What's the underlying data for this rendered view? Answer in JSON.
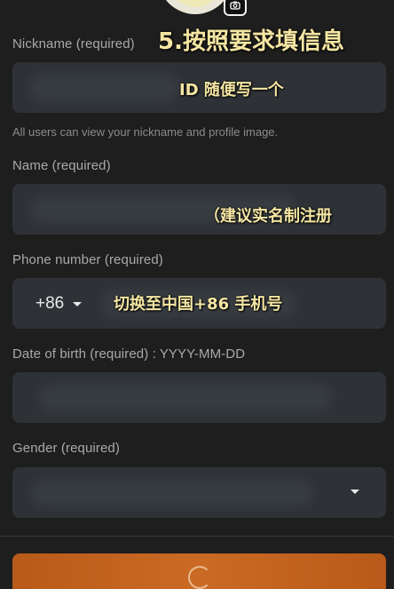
{
  "annotations": {
    "step_title": "5.按照要求填信息",
    "nickname_note": "ID 随便写一个",
    "name_note": "（建议实名制注册",
    "phone_note": "切换至中国+86 手机号"
  },
  "form": {
    "nickname": {
      "label": "Nickname (required)",
      "hint": "All users can view your nickname and profile image."
    },
    "name": {
      "label": "Name (required)"
    },
    "phone": {
      "label": "Phone number (required)",
      "country_code": "+86"
    },
    "dob": {
      "label": "Date of birth (required) : YYYY-MM-DD"
    },
    "gender": {
      "label": "Gender (required)"
    }
  },
  "icons": {
    "avatar_badge": "camera-icon",
    "country_caret": "caret-down-icon",
    "gender_caret": "caret-down-icon",
    "submit_spinner": "spinner-icon"
  },
  "colors": {
    "background": "#1e1e1e",
    "field": "#2e3236",
    "submit_button": "#c2621f",
    "annotation": "#f5e6a3"
  }
}
